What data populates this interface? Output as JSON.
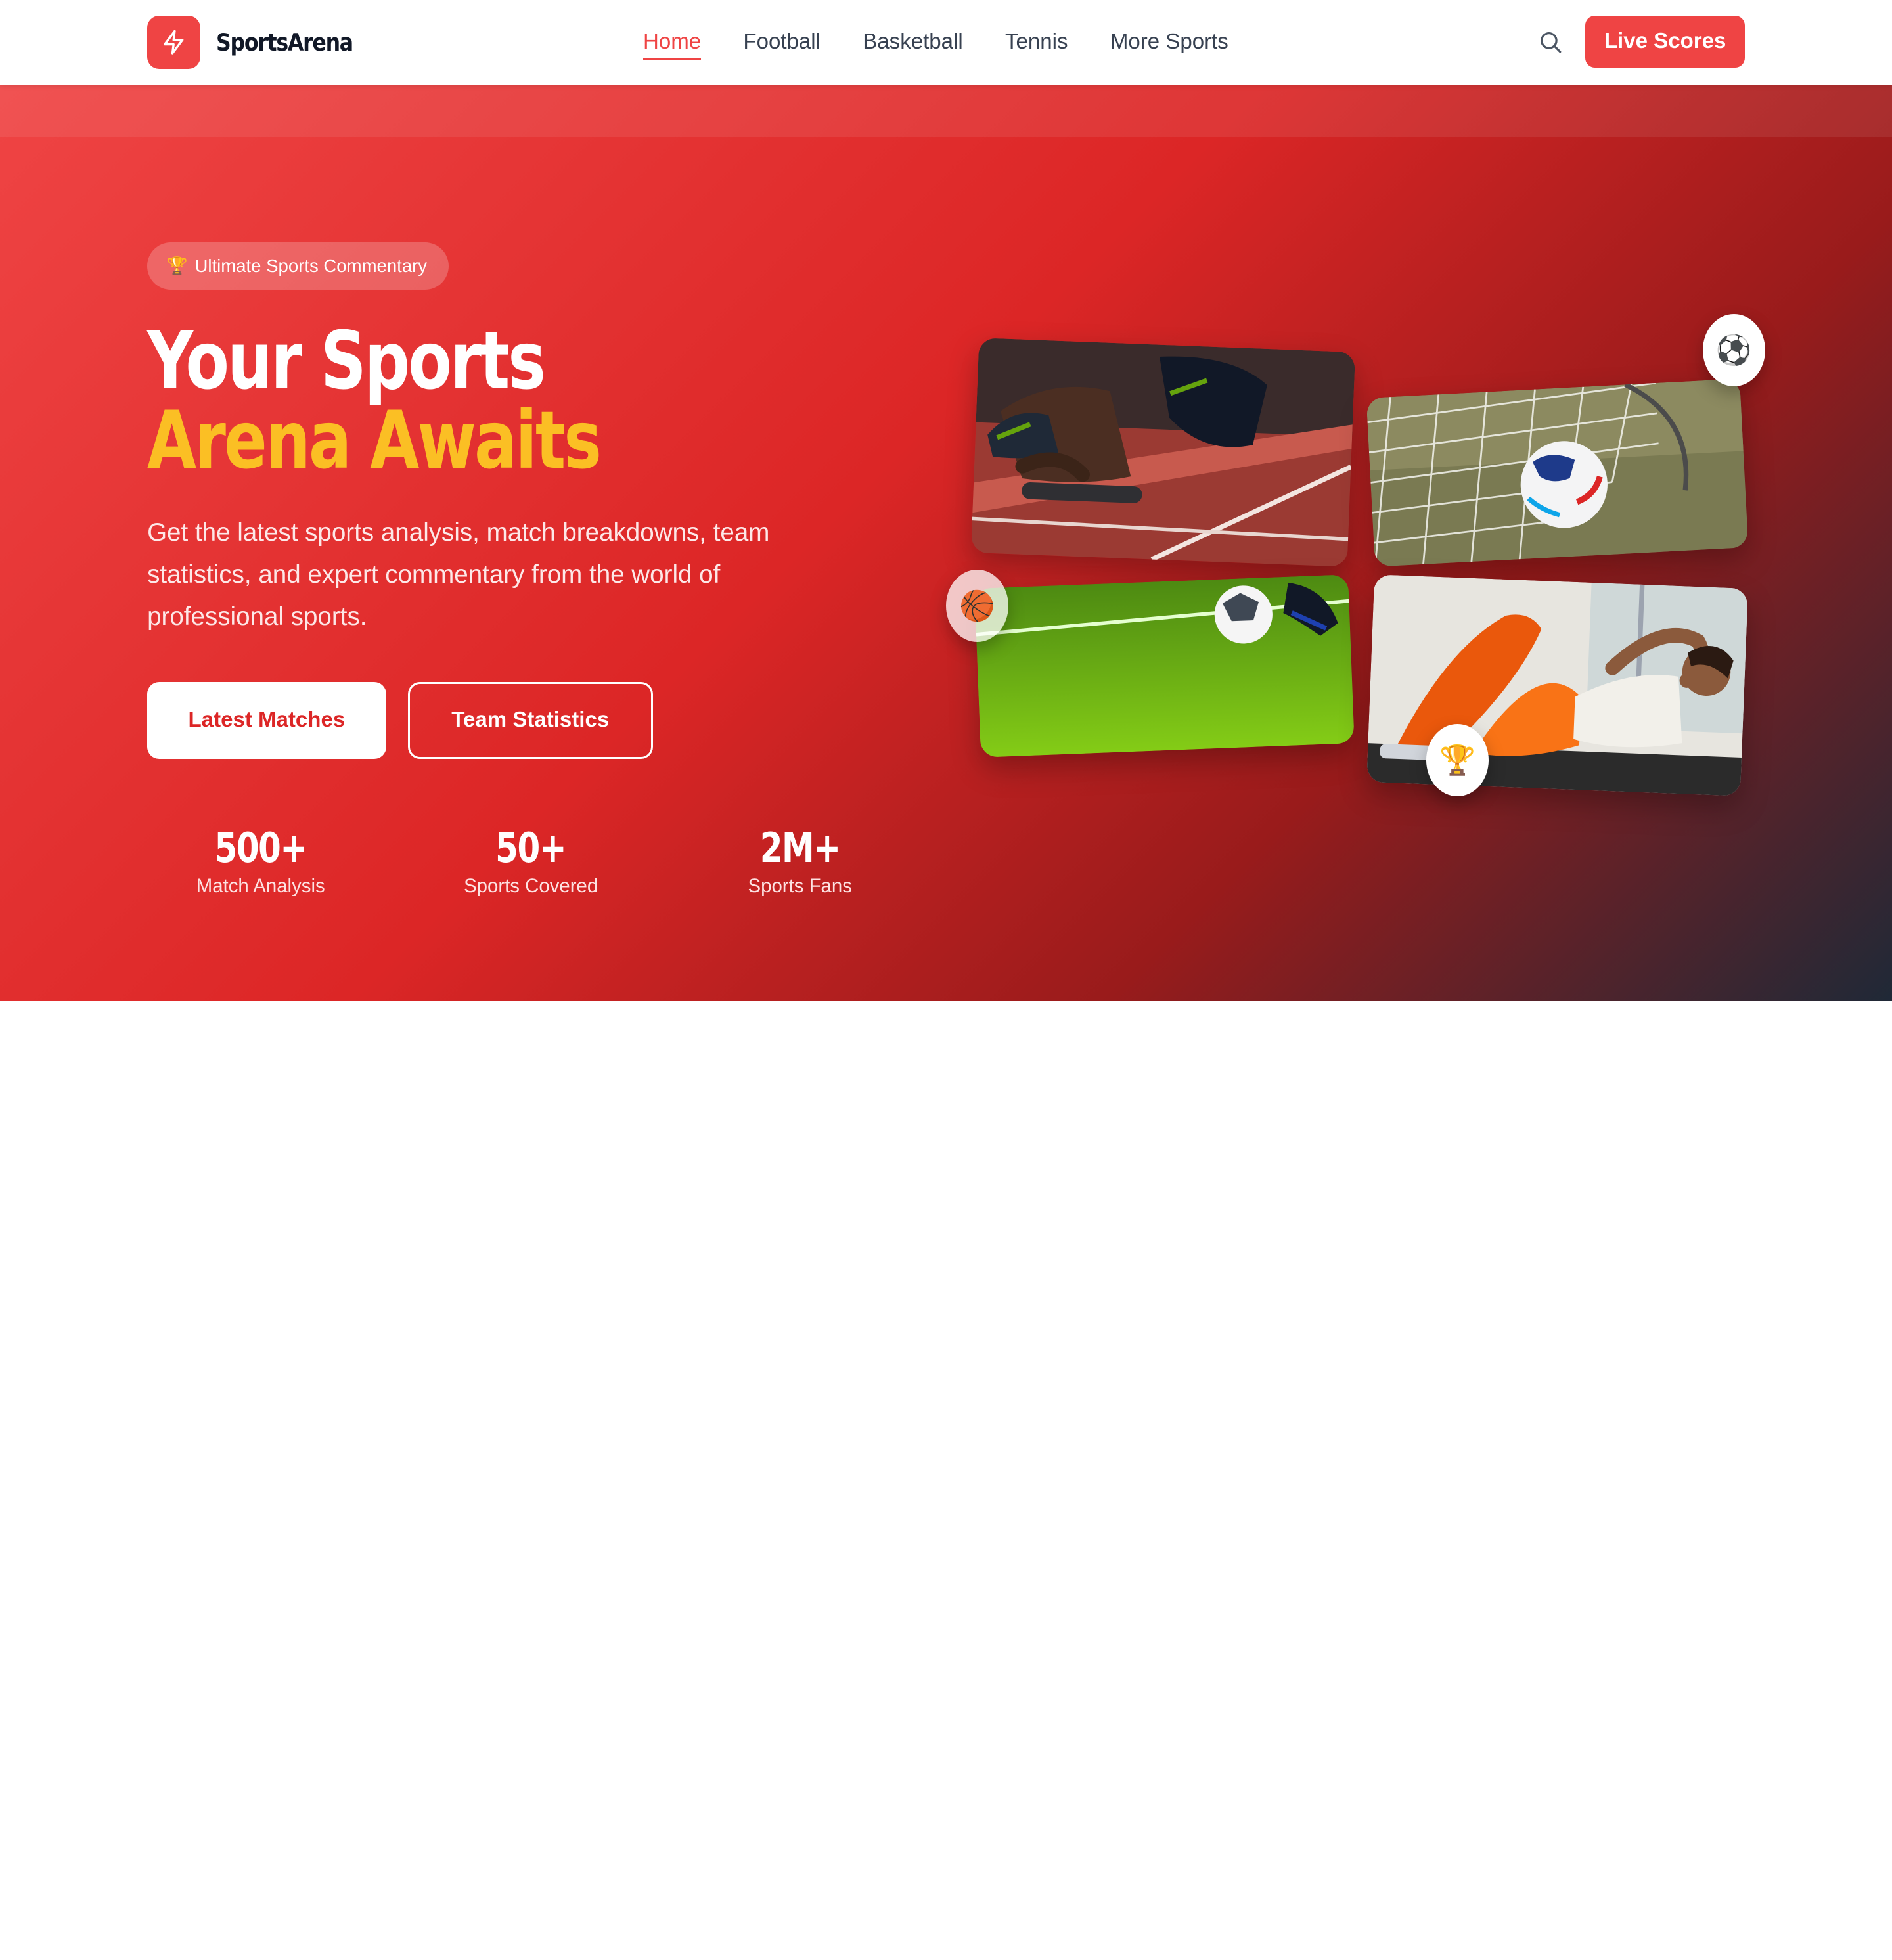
{
  "brand": {
    "name": "SportsArena",
    "logo_icon": "lightning-bolt-icon",
    "color": "#ef4444"
  },
  "nav": {
    "items": [
      {
        "label": "Home",
        "active": true
      },
      {
        "label": "Football",
        "active": false
      },
      {
        "label": "Basketball",
        "active": false
      },
      {
        "label": "Tennis",
        "active": false
      },
      {
        "label": "More Sports",
        "active": false
      }
    ],
    "search_icon": "search-icon",
    "cta_label": "Live Scores"
  },
  "hero": {
    "badge": {
      "icon": "🏆",
      "label": "Ultimate Sports Commentary"
    },
    "title_line1": "Your Sports",
    "title_line2": "Arena Awaits",
    "description": "Get the latest sports analysis, match breakdowns, team statistics, and expert commentary from the world of professional sports.",
    "primary_button": "Latest Matches",
    "secondary_button": "Team Statistics",
    "stats": [
      {
        "value": "500+",
        "label": "Match Analysis"
      },
      {
        "value": "50+",
        "label": "Sports Covered"
      },
      {
        "value": "2M+",
        "label": "Sports Fans"
      }
    ],
    "gradient_colors": [
      "#ef4444",
      "#dc2626",
      "#991b1b",
      "#1f2937"
    ],
    "accent_color": "#fbbf24"
  },
  "gallery": {
    "images": [
      "sprinter-starting-blocks",
      "soccer-ball-in-goal-net",
      "soccer-ball-on-grass",
      "woman-doing-situps"
    ],
    "floating_icons": [
      "⚽",
      "🏀",
      "🏆"
    ]
  }
}
